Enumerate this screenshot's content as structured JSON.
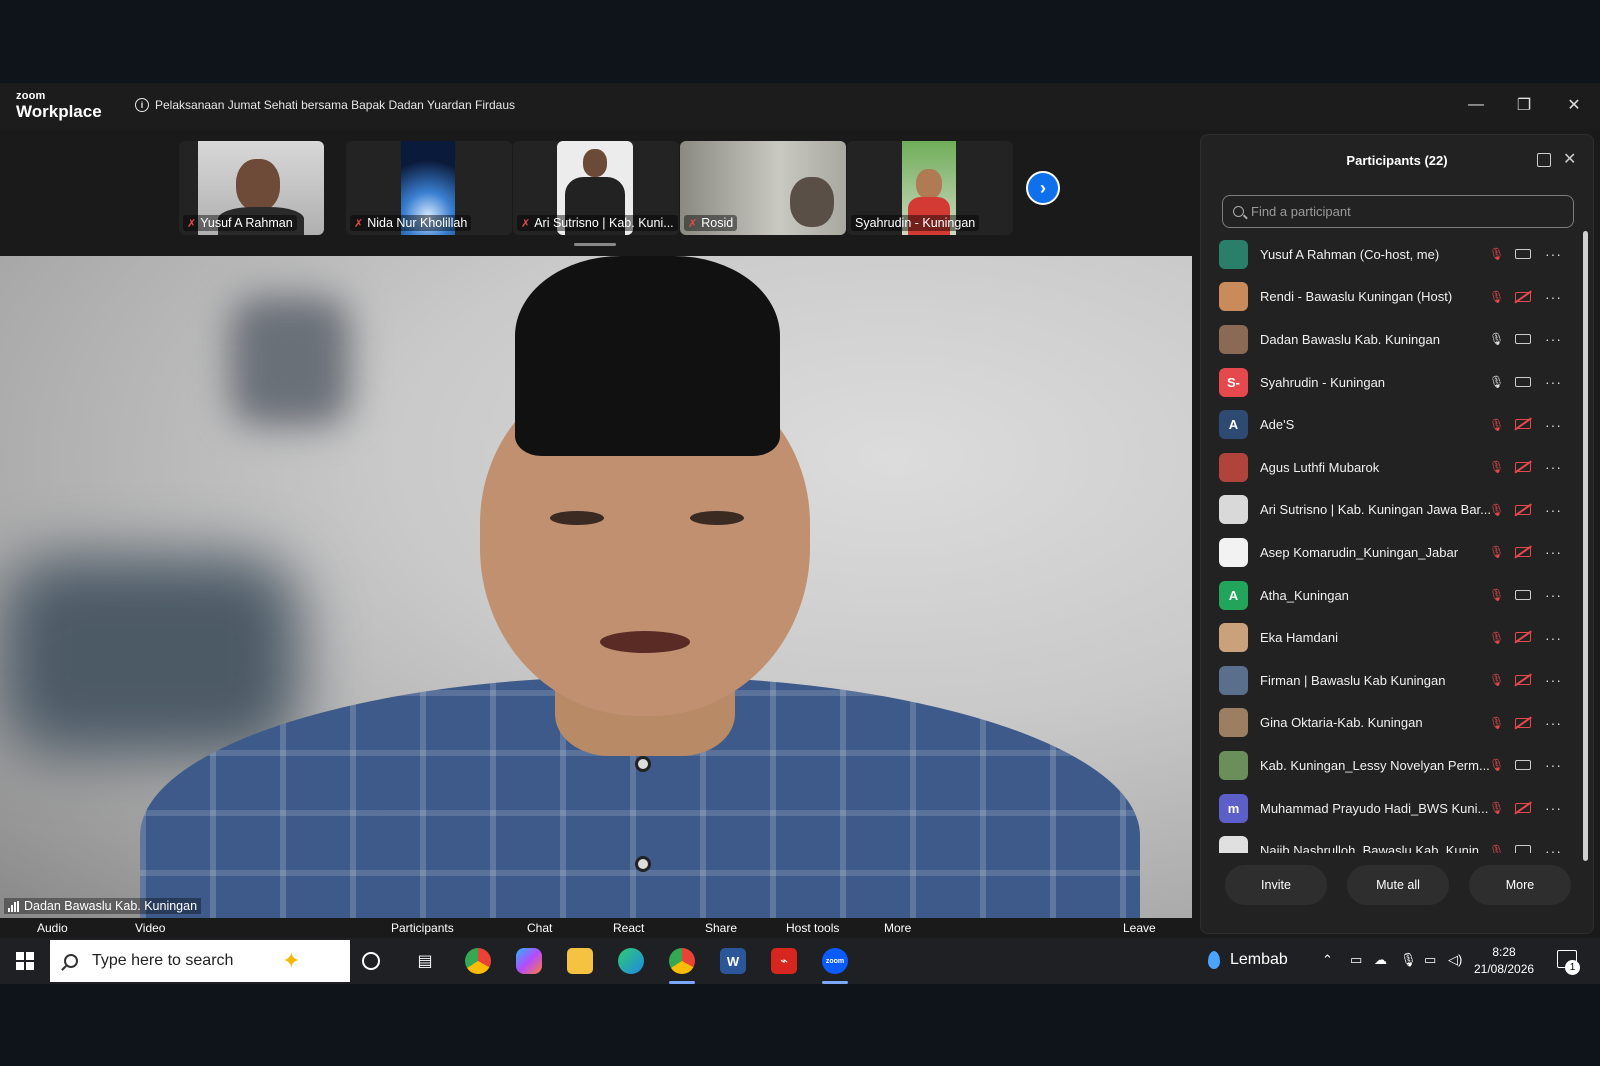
{
  "window": {
    "app_brand_line1": "zoom",
    "app_brand_line2": "Workplace",
    "meeting_title": "Pelaksanaan Jumat Sehati bersama Bapak Dadan Yuardan Firdaus",
    "minimize_glyph": "—",
    "restore_glyph": "❐",
    "close_glyph": "✕"
  },
  "gallery": {
    "thumbnails": [
      {
        "name": "Yusuf A Rahman",
        "muted": true
      },
      {
        "name": "Nida Nur Kholillah",
        "muted": true
      },
      {
        "name": "Ari Sutrisno | Kab. Kuni...",
        "muted": true
      },
      {
        "name": "Rosid",
        "muted": true
      },
      {
        "name": "Syahrudin - Kuningan",
        "muted": false
      }
    ],
    "next_glyph": "›"
  },
  "main_video": {
    "speaker_name": "Dadan Bawaslu Kab. Kuningan"
  },
  "toolbar": {
    "audio": "Audio",
    "video": "Video",
    "participants": "Participants",
    "chat": "Chat",
    "react": "React",
    "share": "Share",
    "host_tools": "Host tools",
    "more": "More",
    "leave": "Leave"
  },
  "participants_panel": {
    "title": "Participants (22)",
    "search_placeholder": "Find a participant",
    "participants": [
      {
        "name": "Yusuf A Rahman (Co-host, me)",
        "avatar": "",
        "avatar_color": "#2a7f6a",
        "mic": "muted",
        "video": "on"
      },
      {
        "name": "Rendi - Bawaslu Kuningan (Host)",
        "avatar": "",
        "avatar_color": "#c98b5a",
        "mic": "muted",
        "video": "off"
      },
      {
        "name": "Dadan Bawaslu Kab. Kuningan",
        "avatar": "",
        "avatar_color": "#8a6a55",
        "mic": "on",
        "video": "on"
      },
      {
        "name": "Syahrudin - Kuningan",
        "avatar": "S-",
        "avatar_color": "#e5484d",
        "mic": "on",
        "video": "on"
      },
      {
        "name": "Ade'S",
        "avatar": "A",
        "avatar_color": "#2e4a73",
        "mic": "muted",
        "video": "off"
      },
      {
        "name": "Agus Luthfi Mubarok",
        "avatar": "",
        "avatar_color": "#b0443c",
        "mic": "muted",
        "video": "off"
      },
      {
        "name": "Ari Sutrisno | Kab. Kuningan Jawa Bar...",
        "avatar": "",
        "avatar_color": "#d9d9d9",
        "mic": "muted",
        "video": "off"
      },
      {
        "name": "Asep Komarudin_Kuningan_Jabar",
        "avatar": "",
        "avatar_color": "#f2f2f2",
        "mic": "muted",
        "video": "off"
      },
      {
        "name": "Atha_Kuningan",
        "avatar": "A",
        "avatar_color": "#22a55b",
        "mic": "muted",
        "video": "on"
      },
      {
        "name": "Eka Hamdani",
        "avatar": "",
        "avatar_color": "#c9a27c",
        "mic": "muted",
        "video": "off"
      },
      {
        "name": "Firman | Bawaslu Kab Kuningan",
        "avatar": "",
        "avatar_color": "#5a6f8c",
        "mic": "muted",
        "video": "off"
      },
      {
        "name": "Gina Oktaria-Kab. Kuningan",
        "avatar": "",
        "avatar_color": "#9c7f62",
        "mic": "muted",
        "video": "off"
      },
      {
        "name": "Kab. Kuningan_Lessy Novelyan Perm...",
        "avatar": "",
        "avatar_color": "#6b8f5a",
        "mic": "muted",
        "video": "on"
      },
      {
        "name": "Muhammad Prayudo Hadi_BWS Kuni...",
        "avatar": "m",
        "avatar_color": "#5b5fc7",
        "mic": "muted",
        "video": "off"
      },
      {
        "name": "Najib Nashrulloh_Bawaslu Kab. Kunin...",
        "avatar": "",
        "avatar_color": "#e0e0e0",
        "mic": "muted",
        "video": "on"
      }
    ],
    "more_glyph": "···",
    "mic_on_glyph": "🎙",
    "mic_off_glyph": "🎙",
    "buttons": {
      "invite": "Invite",
      "mute_all": "Mute all",
      "more": "More"
    }
  },
  "taskbar": {
    "search_placeholder": "Type here to search",
    "weather": "Lembab",
    "time": "8:28",
    "date": "21/08/2026",
    "notification_count": "1"
  },
  "colors": {
    "accent_blue": "#0e71eb",
    "muted_red": "#e5484d",
    "panel_bg": "#222222"
  }
}
